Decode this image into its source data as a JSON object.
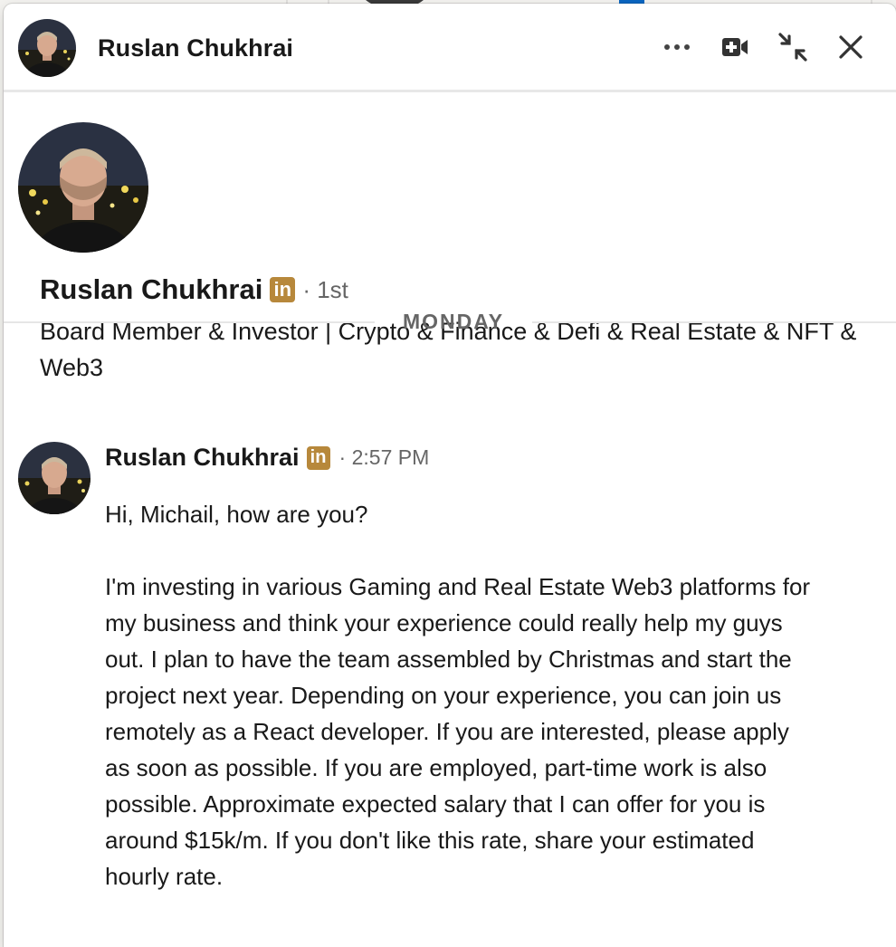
{
  "contact": {
    "name": "Ruslan Chukhrai",
    "badge": "in",
    "degree": "· 1st",
    "headline": "Board Member & Investor | Crypto & Finance & Defi & Real Estate & NFT & Web3"
  },
  "header": {
    "title": "Ruslan Chukhrai",
    "actions": {
      "more": "more-options",
      "video": "video-call",
      "minimize": "minimize",
      "close": "close"
    }
  },
  "divider": {
    "label": "MONDAY"
  },
  "message": {
    "sender": "Ruslan Chukhrai",
    "badge": "in",
    "time": "· 2:57 PM",
    "paragraph_1": "Hi, Michail, how are you?",
    "paragraph_2": "I'm investing in various Gaming and Real Estate Web3 platforms for my business and think your experience could really help my guys out. I plan to have the team assembled by Christmas and start the project next year. Depending on your experience, you can join us remotely as a React developer. If you are interested, please apply as soon as possible. If you are employed, part-time work is also possible. Approximate expected salary that I can offer for you is around $15k/m. If you don't like this rate, share your estimated hourly rate."
  },
  "colors": {
    "premium_badge": "#b7883b",
    "text_primary": "#191919",
    "text_secondary": "#666666",
    "divider": "#e6e6e6"
  }
}
